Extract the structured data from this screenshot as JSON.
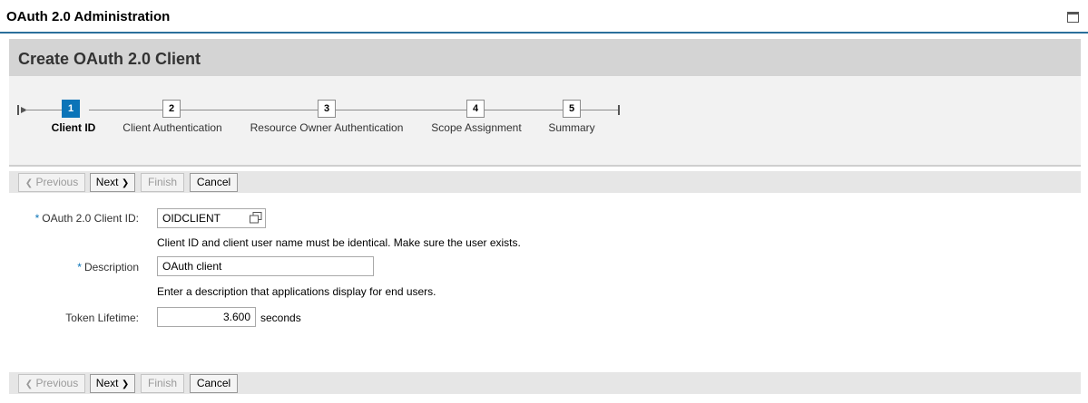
{
  "app": {
    "title": "OAuth 2.0 Administration"
  },
  "panel": {
    "title": "Create OAuth 2.0 Client"
  },
  "wizard": {
    "active_step": 1,
    "steps": [
      {
        "number": "1",
        "label": "Client ID"
      },
      {
        "number": "2",
        "label": "Client Authentication"
      },
      {
        "number": "3",
        "label": "Resource Owner Authentication"
      },
      {
        "number": "4",
        "label": "Scope Assignment"
      },
      {
        "number": "5",
        "label": "Summary"
      }
    ]
  },
  "buttons": {
    "previous": "Previous",
    "next": "Next",
    "finish": "Finish",
    "cancel": "Cancel"
  },
  "form": {
    "required_marker": "*",
    "client_id": {
      "label": "OAuth 2.0 Client ID:",
      "value": "OIDCLIENT",
      "hint": "Client ID and client user name must be identical. Make sure the user exists."
    },
    "description": {
      "label": "Description",
      "value": "OAuth client",
      "hint": "Enter a description that applications display for end users."
    },
    "token_lifetime": {
      "label": "Token Lifetime:",
      "value": "3.600",
      "unit": "seconds"
    }
  },
  "colors": {
    "accent": "#0b74b8",
    "header_rule": "#2a6f9b",
    "panel_header": "#d4d4d4",
    "wizard_bg": "#f2f2f2"
  },
  "icons": {
    "maximize": "maximize-icon",
    "wizard_start": "wizard-start-icon",
    "wizard_end": "wizard-end-icon",
    "value_help": "value-help-icon"
  }
}
